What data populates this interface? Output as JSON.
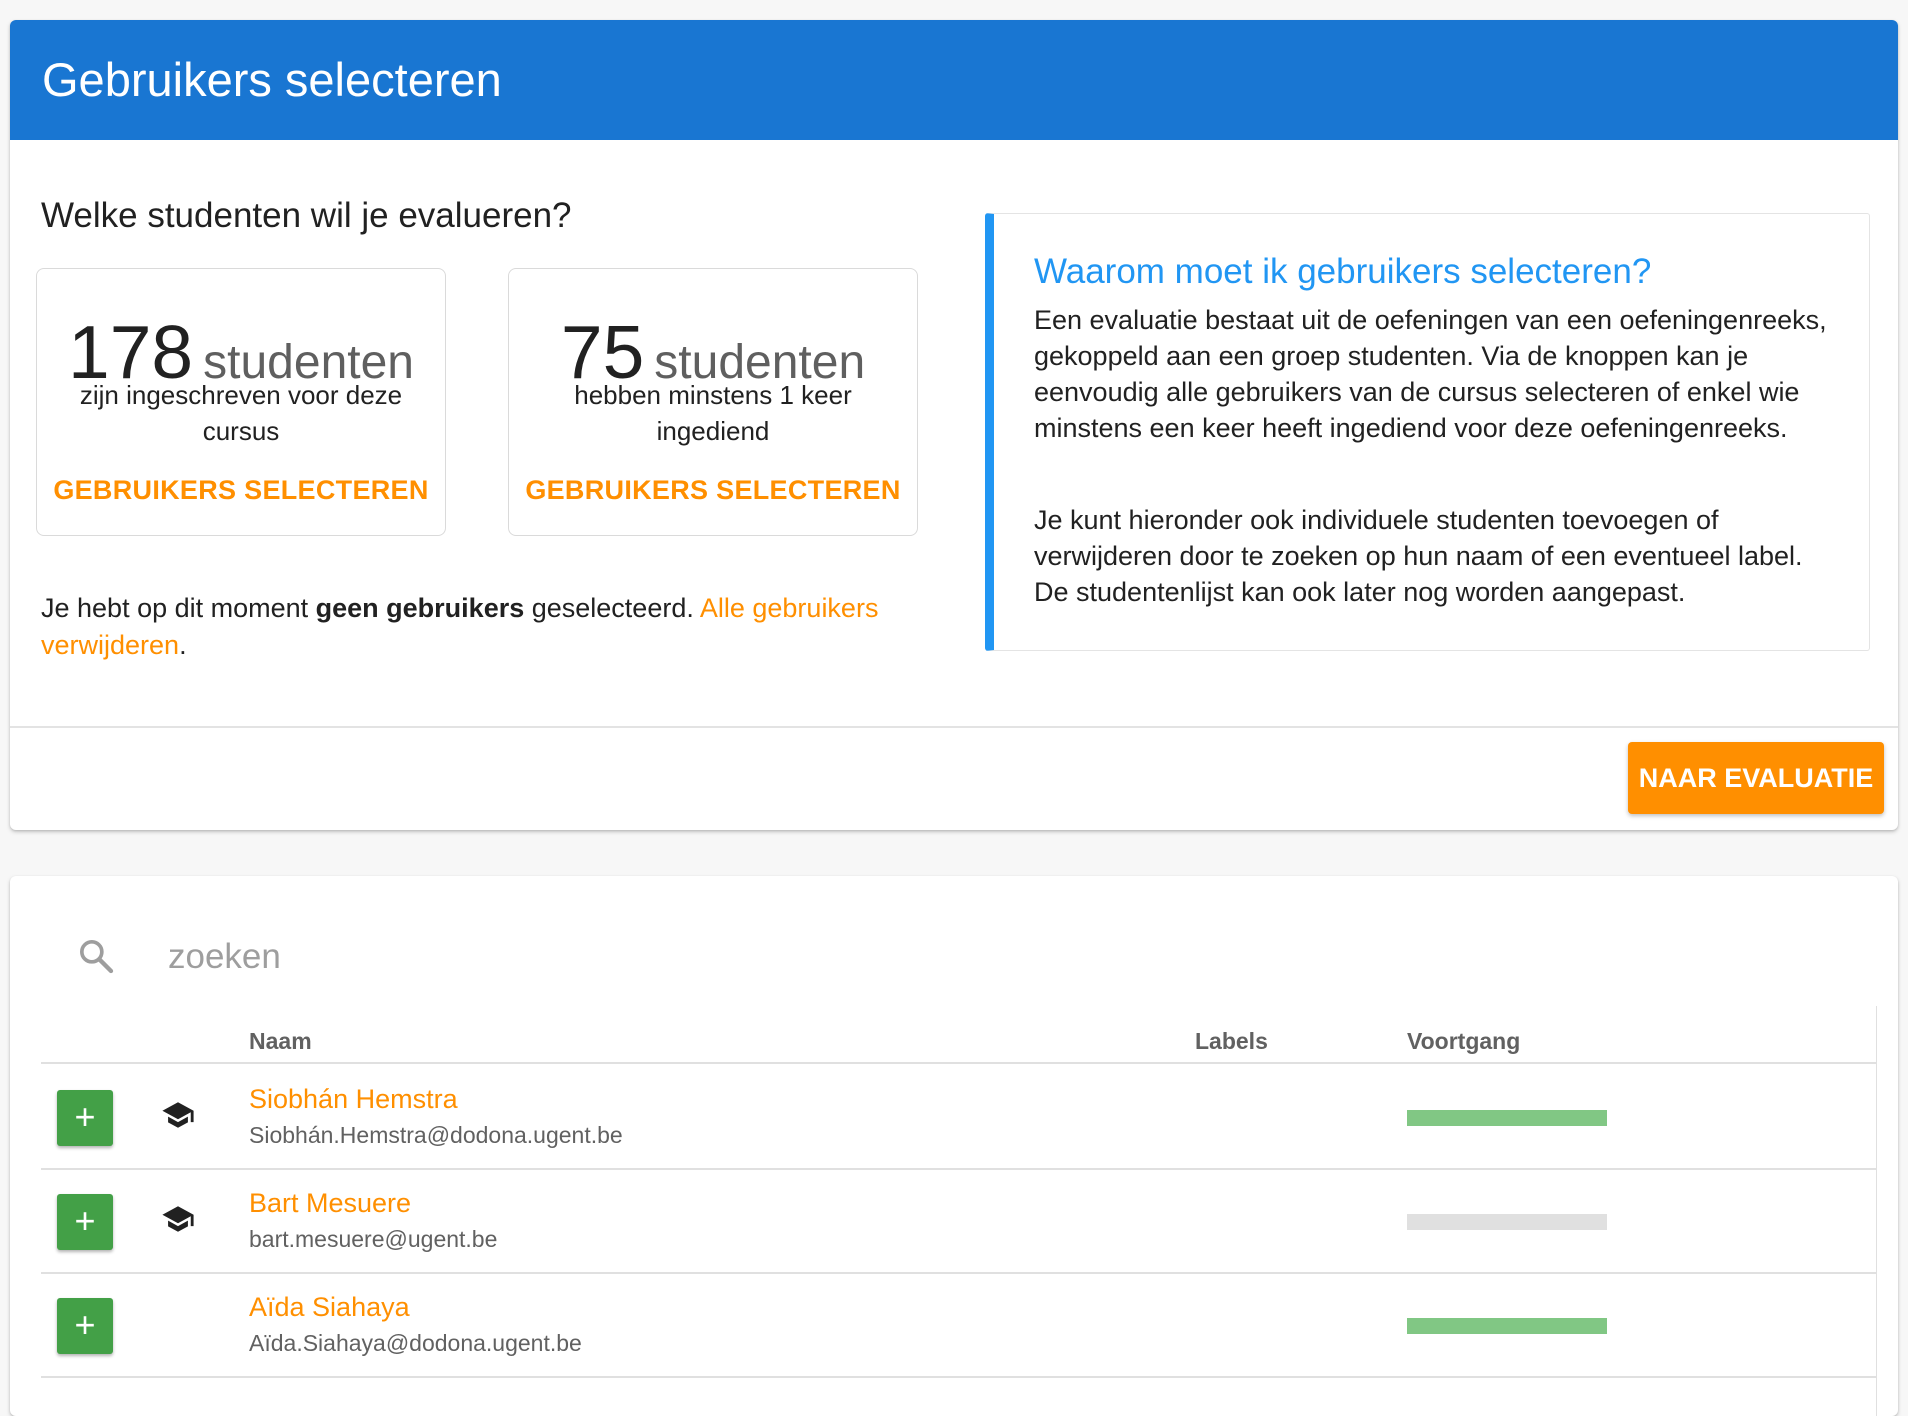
{
  "header": {
    "title": "Gebruikers selecteren"
  },
  "selection": {
    "question": "Welke studenten wil je evalueren?",
    "boxes": [
      {
        "count": "178",
        "unit": "studenten",
        "description": "zijn ingeschreven voor deze cursus",
        "button_label": "GEBRUIKERS SELECTEREN"
      },
      {
        "count": "75",
        "unit": "studenten",
        "description": "hebben minstens 1 keer ingediend",
        "button_label": "GEBRUIKERS SELECTEREN"
      }
    ],
    "status_prefix": "Je hebt op dit moment ",
    "status_bold": "geen gebruikers",
    "status_suffix": " geselecteerd. ",
    "remove_all_link": "Alle gebruikers verwijderen",
    "status_end": "."
  },
  "info": {
    "title": "Waarom moet ik gebruikers selecteren?",
    "paragraph1": "Een evaluatie bestaat uit de oefeningen van een oefeningenreeks, gekoppeld aan een groep studenten. Via de knoppen kan je eenvoudig alle gebruikers van de cursus selecteren of enkel wie minstens een keer heeft ingediend voor deze oefeningenreeks.",
    "paragraph2": "Je kunt hieronder ook individuele studenten toevoegen of verwijderen door te zoeken op hun naam of een eventueel label. De studentenlijst kan ook later nog worden aangepast."
  },
  "footer": {
    "primary_button": "NAAR EVALUATIE"
  },
  "search": {
    "value": "",
    "placeholder": "zoeken"
  },
  "table": {
    "columns": {
      "name": "Naam",
      "labels": "Labels",
      "progress": "Voortgang"
    },
    "add_symbol": "+",
    "rows": [
      {
        "name": "Siobhán Hemstra",
        "email": "Siobhán.Hemstra@dodona.ugent.be",
        "student_icon": true,
        "progress": 1.0
      },
      {
        "name": "Bart Mesuere",
        "email": "bart.mesuere@ugent.be",
        "student_icon": true,
        "progress": 0.0
      },
      {
        "name": "Aïda Siahaya",
        "email": "Aïda.Siahaya@dodona.ugent.be",
        "student_icon": false,
        "progress": 1.0
      }
    ]
  },
  "colors": {
    "header": "#1976d2",
    "accent": "#ff8f00",
    "info_accent": "#2196f3",
    "add_button": "#43a047",
    "progress_fill": "#81c784",
    "progress_track": "#e0e0e0"
  }
}
